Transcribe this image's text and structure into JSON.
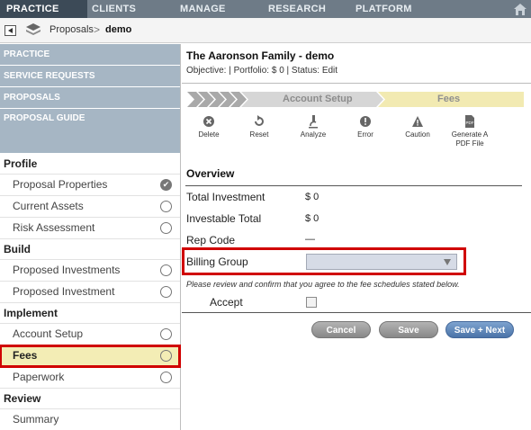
{
  "topnav": {
    "tabs": [
      "PRACTICE",
      "CLIENTS",
      "MANAGE",
      "RESEARCH",
      "PLATFORM"
    ]
  },
  "breadcrumb": {
    "items": [
      "Proposals",
      "demo"
    ],
    "separator": ">"
  },
  "sidebar": {
    "sections": [
      "PRACTICE",
      "SERVICE REQUESTS",
      "PROPOSALS",
      "PROPOSAL GUIDE"
    ],
    "groups": {
      "profile": {
        "label": "Profile",
        "items": [
          {
            "label": "Proposal Properties",
            "state": "complete"
          },
          {
            "label": "Current Assets",
            "state": "open"
          },
          {
            "label": "Risk Assessment",
            "state": "open"
          }
        ]
      },
      "build": {
        "label": "Build",
        "items": [
          {
            "label": "Proposed Investments",
            "state": "open"
          },
          {
            "label": "Proposed Investment",
            "state": "open"
          }
        ]
      },
      "implement": {
        "label": "Implement",
        "items": [
          {
            "label": "Account Setup",
            "state": "open"
          },
          {
            "label": "Fees",
            "state": "active"
          },
          {
            "label": "Paperwork",
            "state": "open"
          }
        ]
      },
      "review": {
        "label": "Review",
        "items": [
          {
            "label": "Summary",
            "state": "open"
          }
        ]
      }
    }
  },
  "main": {
    "title": "The Aaronson Family - demo",
    "subtitle": "Objective:  |  Portfolio: $ 0  |  Status: Edit",
    "steps": [
      "Account Setup",
      "Fees"
    ],
    "toolbar": {
      "delete": "Delete",
      "reset": "Reset",
      "analyze": "Analyze",
      "error": "Error",
      "caution": "Caution",
      "pdf_line1": "Generate A",
      "pdf_line2": "PDF File",
      "pdf_icon_text": "PDF"
    },
    "overview": {
      "title": "Overview",
      "total_investment_label": "Total Investment",
      "total_investment_value": "$ 0",
      "investable_total_label": "Investable Total",
      "investable_total_value": "$ 0",
      "rep_code_label": "Rep Code",
      "rep_code_value": "—",
      "billing_group_label": "Billing Group",
      "billing_group_value": "",
      "note": "Please review and confirm that you agree to the fee schedules stated below.",
      "accept_label": "Accept",
      "accept_checked": false
    },
    "buttons": {
      "cancel": "Cancel",
      "save": "Save",
      "save_next": "Save + Next"
    }
  },
  "colors": {
    "nav_bg": "#6e7b87",
    "nav_active": "#3c4a57",
    "sidebar_section": "#a6b6c4",
    "active_item_bg": "#f3edb5",
    "highlight_red": "#d00000",
    "primary_button": "#4a73a8"
  }
}
